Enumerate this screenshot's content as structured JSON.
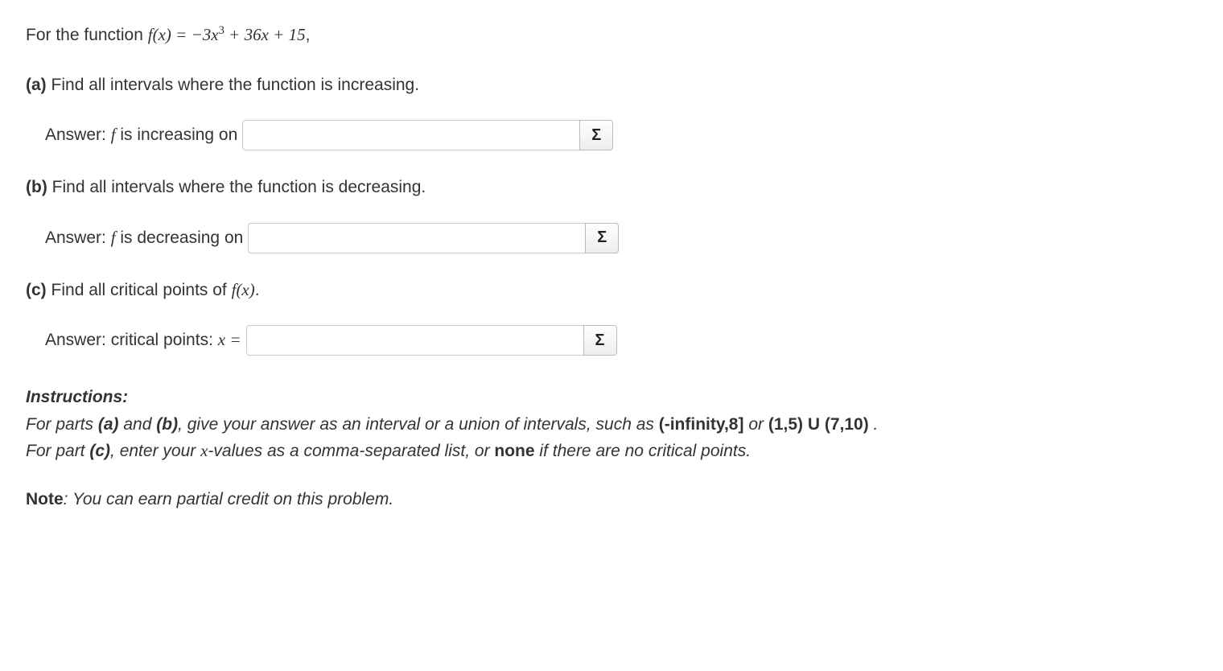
{
  "intro": {
    "prefix": "For the function ",
    "func": "f(x) = −3x",
    "exp": "3",
    "suffix": " + 36x + 15",
    "trailing": ","
  },
  "sigma": "Σ",
  "parts": {
    "a": {
      "label": "(a)",
      "text": "Find all intervals where the function is increasing.",
      "answerPrefix": "Answer: ",
      "f": "f",
      "is": " is increasing on"
    },
    "b": {
      "label": "(b)",
      "text": "Find all intervals where the function is decreasing.",
      "answerPrefix": "Answer: ",
      "f": "f",
      "is": " is decreasing on"
    },
    "c": {
      "label": "(c)",
      "text": "Find all critical points of ",
      "func": "f(x)",
      "dot": ".",
      "answerPrefix": "Answer: critical points: ",
      "xeq": "x ="
    }
  },
  "instructions": {
    "title": "Instructions:",
    "line1a": "For parts ",
    "line1b": "(a)",
    "line1c": " and ",
    "line1d": "(b)",
    "line1e": ", give your answer as an interval or a union of intervals, such as ",
    "line1f": "(-infinity,8]",
    "line1g": " or ",
    "line1h": "(1,5) U (7,10)",
    "line1i": " .",
    "line2a": "For part ",
    "line2b": "(c)",
    "line2c": ", enter your ",
    "line2d": "x",
    "line2e": "-values as a comma-separated list, or ",
    "line2f": "none",
    "line2g": " if there are no critical points."
  },
  "note": {
    "label": "Note",
    "colon": ": ",
    "text": "You can earn partial credit on this problem."
  }
}
